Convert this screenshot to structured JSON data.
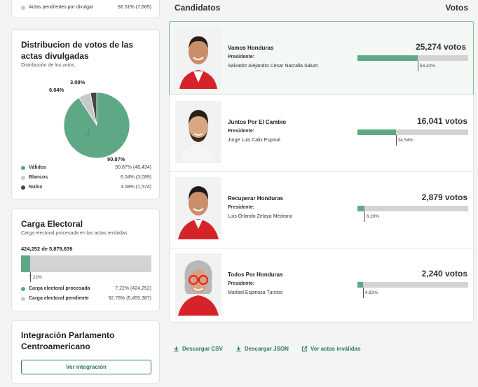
{
  "pending": {
    "label": "Actas pendientes por divulgar",
    "value": "92.51% (7,665)"
  },
  "distribution": {
    "title": "Distribucion de votos de las actas divulgadas",
    "subtitle": "Distribución de los votos.",
    "pie_labels": {
      "validos": "90.87%",
      "blancos": "6.04%",
      "nulos": "3.08%"
    },
    "legend": [
      {
        "label": "Válidos",
        "value": "90.87% (46,434)",
        "color": "#5fa886"
      },
      {
        "label": "Blancos",
        "value": "6.04% (3,089)",
        "color": "#c8c8c8"
      },
      {
        "label": "Nulos",
        "value": "3.08% (1,574)",
        "color": "#444444"
      }
    ],
    "pie_values": [
      90.87,
      6.04,
      3.08
    ]
  },
  "carga": {
    "title": "Carga Electoral",
    "subtitle": "Carga electoral procesada en las actas recibidas.",
    "progress_text": "424,252 de 5,879,639",
    "percent": 7.22,
    "percent_label": "7.22%",
    "legend": [
      {
        "label": "Carga electoral procesada",
        "value": "7.22% (424,252)",
        "color": "#5fa886"
      },
      {
        "label": "Carga electoral pendiente",
        "value": "92.78% (5,455,387)",
        "color": "#c8c8c8"
      }
    ]
  },
  "parlamento": {
    "title": "Integración Parlamento Centroamericano",
    "button": "Ver integración"
  },
  "header": {
    "left": "Candidatos",
    "right": "Votos"
  },
  "candidates": [
    {
      "party": "Vamos Honduras",
      "pres_label": "Presidente:",
      "name": "Salvador Alejandro Cesar Nasralla Salum",
      "votes": "25,274 votos",
      "percent": 54.42,
      "percent_label": "54.42%",
      "active": true
    },
    {
      "party": "Juntos Por El Cambio",
      "pres_label": "Presidente:",
      "name": "Jorge Luis Calix Espinal",
      "votes": "16,041 votos",
      "percent": 34.54,
      "percent_label": "34.54%",
      "active": false
    },
    {
      "party": "Recuperar Honduras",
      "pres_label": "Presidente:",
      "name": "Luis Orlando Zelaya Medrano",
      "votes": "2,879 votos",
      "percent": 6.2,
      "percent_label": "6.20%",
      "active": false
    },
    {
      "party": "Todos Por Honduras",
      "pres_label": "Presidente:",
      "name": "Maribel Espinoza Turcios",
      "votes": "2,240 votos",
      "percent": 4.82,
      "percent_label": "4.82%",
      "active": false
    }
  ],
  "links": {
    "csv": "Descargar CSV",
    "json": "Descargar JSON",
    "invalid": "Ver actas inválidas"
  },
  "colors": {
    "accent": "#2c7a5b",
    "bar": "#5fa886",
    "track": "#d3d3d3"
  }
}
